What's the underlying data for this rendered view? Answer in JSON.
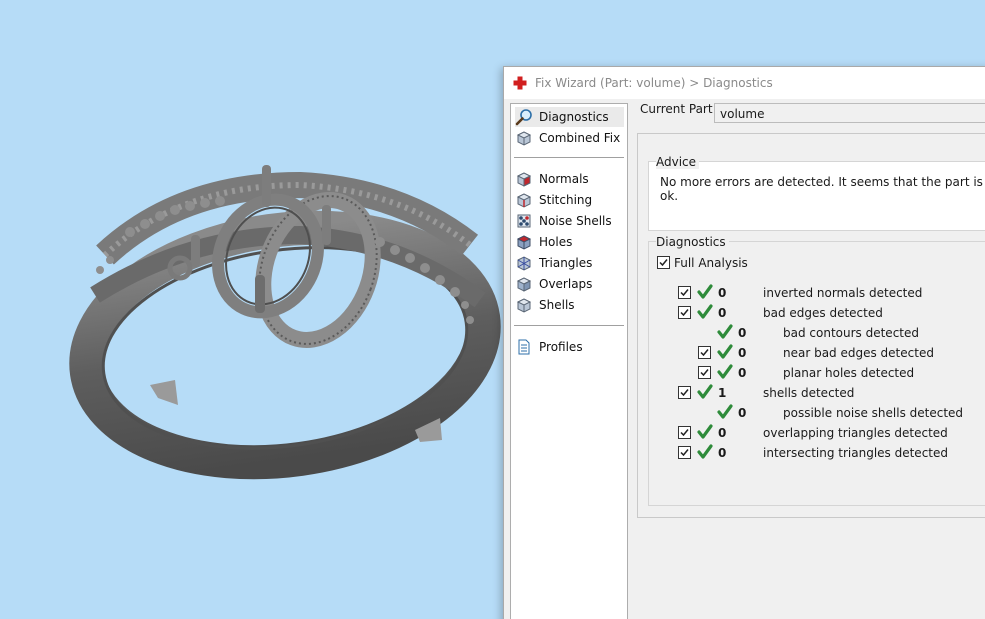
{
  "window": {
    "title": "Fix Wizard (Part: volume) > Diagnostics"
  },
  "nav": {
    "items": [
      {
        "label": "Diagnostics",
        "icon": "magnifier-icon"
      },
      {
        "label": "Combined Fix",
        "icon": "cube-icon"
      },
      {
        "label": "Normals",
        "icon": "normals-cube-icon"
      },
      {
        "label": "Stitching",
        "icon": "stitching-cube-icon"
      },
      {
        "label": "Noise Shells",
        "icon": "noise-shells-icon"
      },
      {
        "label": "Holes",
        "icon": "holes-cube-icon"
      },
      {
        "label": "Triangles",
        "icon": "triangles-cube-icon"
      },
      {
        "label": "Overlaps",
        "icon": "overlaps-cube-icon"
      },
      {
        "label": "Shells",
        "icon": "shells-cube-icon"
      },
      {
        "label": "Profiles",
        "icon": "document-icon"
      }
    ]
  },
  "current_part": {
    "label": "Current Part:",
    "value": "volume"
  },
  "advice": {
    "title": "Advice",
    "text": "No more errors are detected. It seems that the part is ok."
  },
  "diagnostics": {
    "title": "Diagnostics",
    "full_analysis_label": "Full Analysis",
    "rows": [
      {
        "count": "0",
        "label": "inverted normals detected"
      },
      {
        "count": "0",
        "label": "bad edges detected"
      },
      {
        "count": "0",
        "label": "bad contours detected"
      },
      {
        "count": "0",
        "label": "near bad edges detected"
      },
      {
        "count": "0",
        "label": "planar holes detected"
      },
      {
        "count": "1",
        "label": "shells detected"
      },
      {
        "count": "0",
        "label": "possible noise shells detected"
      },
      {
        "count": "0",
        "label": "overlapping triangles detected"
      },
      {
        "count": "0",
        "label": "intersecting triangles detected"
      }
    ]
  },
  "colors": {
    "viewport_bg": "#b6dcf7",
    "ring": "#6e6e6e",
    "check_green": "#2e8b3a"
  }
}
